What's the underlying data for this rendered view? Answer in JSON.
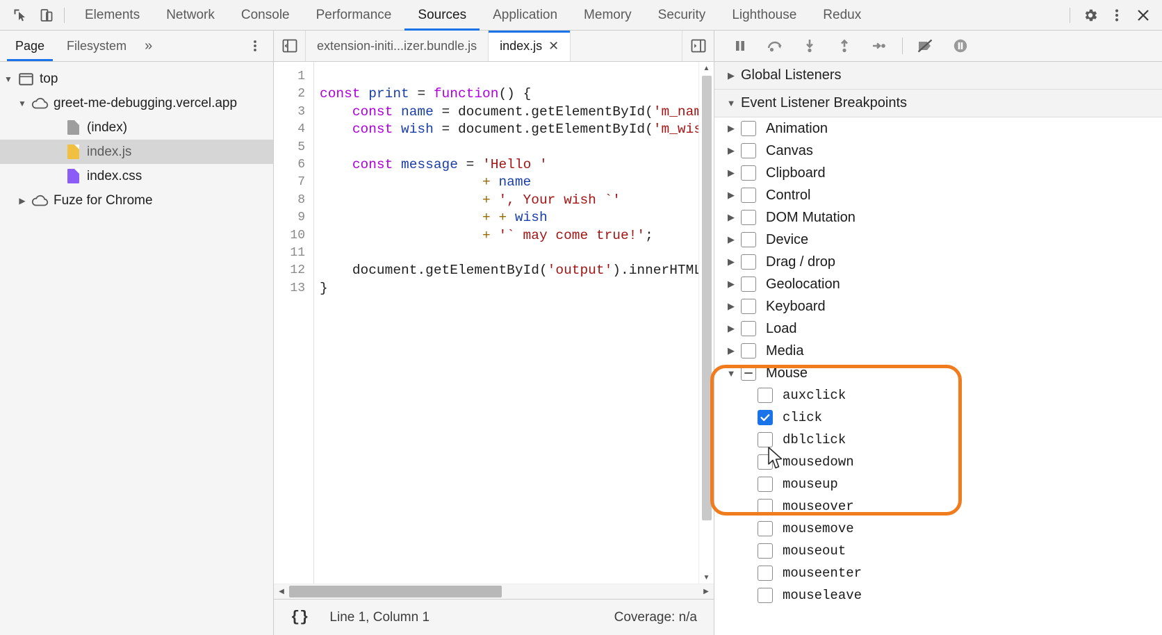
{
  "toolbar": {
    "icons": [
      {
        "name": "inspect-element-icon",
        "title": "Inspect element"
      },
      {
        "name": "device-toolbar-icon",
        "title": "Toggle device toolbar"
      }
    ],
    "tabs": [
      {
        "label": "Elements",
        "active": false
      },
      {
        "label": "Network",
        "active": false
      },
      {
        "label": "Console",
        "active": false
      },
      {
        "label": "Performance",
        "active": false
      },
      {
        "label": "Sources",
        "active": true
      },
      {
        "label": "Application",
        "active": false
      },
      {
        "label": "Memory",
        "active": false
      },
      {
        "label": "Security",
        "active": false
      },
      {
        "label": "Lighthouse",
        "active": false
      },
      {
        "label": "Redux",
        "active": false
      }
    ],
    "right_icons": [
      {
        "name": "gear-icon",
        "title": "Settings"
      },
      {
        "name": "kebab-menu-icon",
        "title": "Customize and control DevTools"
      },
      {
        "name": "close-icon",
        "title": "Close DevTools"
      }
    ]
  },
  "navigator": {
    "tabs": [
      {
        "label": "Page",
        "active": true
      },
      {
        "label": "Filesystem",
        "active": false
      }
    ],
    "more_label": "»",
    "kebab_name": "navigator-more-options",
    "tree": [
      {
        "label": "top",
        "depth": 0,
        "twisty": "▼",
        "icon": "frame-icon",
        "selected": false
      },
      {
        "label": "greet-me-debugging.vercel.app",
        "depth": 1,
        "twisty": "▼",
        "icon": "cloud-icon",
        "selected": false
      },
      {
        "label": "(index)",
        "depth": 2,
        "twisty": "",
        "icon": "document-icon-gray",
        "selected": false
      },
      {
        "label": "index.js",
        "depth": 2,
        "twisty": "",
        "icon": "document-icon-yellow",
        "selected": true
      },
      {
        "label": "index.css",
        "depth": 2,
        "twisty": "",
        "icon": "document-icon-purple",
        "selected": false
      },
      {
        "label": "Fuze for Chrome",
        "depth": 1,
        "twisty": "▶",
        "icon": "cloud-icon",
        "selected": false
      }
    ],
    "icon_colors": {
      "document-icon-gray": "#9e9e9e",
      "document-icon-yellow": "#f0c040",
      "document-icon-purple": "#8b5cf6"
    }
  },
  "editor": {
    "nav_toggle_name": "show-navigator-icon",
    "debug_toggle_name": "show-debugger-icon",
    "tabs": [
      {
        "label": "extension-initi...izer.bundle.js",
        "active": false,
        "closable": false
      },
      {
        "label": "index.js",
        "active": true,
        "closable": true,
        "close_label": "✕"
      }
    ],
    "lines": [
      {
        "num": "1",
        "tokens": []
      },
      {
        "num": "2",
        "tokens": [
          {
            "t": "const",
            "c": "k"
          },
          {
            "t": " ",
            "c": "p"
          },
          {
            "t": "print",
            "c": "v"
          },
          {
            "t": " ",
            "c": "p"
          },
          {
            "t": "=",
            "c": "p"
          },
          {
            "t": " ",
            "c": "p"
          },
          {
            "t": "function",
            "c": "k"
          },
          {
            "t": "() {",
            "c": "p"
          }
        ]
      },
      {
        "num": "3",
        "tokens": [
          {
            "t": "    ",
            "c": "p"
          },
          {
            "t": "const",
            "c": "k"
          },
          {
            "t": " ",
            "c": "p"
          },
          {
            "t": "name",
            "c": "v"
          },
          {
            "t": " = ",
            "c": "p"
          },
          {
            "t": "document",
            "c": "p"
          },
          {
            "t": ".getElementById(",
            "c": "p"
          },
          {
            "t": "'m_name'",
            "c": "s"
          },
          {
            "t": ");",
            "c": "p"
          }
        ]
      },
      {
        "num": "4",
        "tokens": [
          {
            "t": "    ",
            "c": "p"
          },
          {
            "t": "const",
            "c": "k"
          },
          {
            "t": " ",
            "c": "p"
          },
          {
            "t": "wish",
            "c": "v"
          },
          {
            "t": " = ",
            "c": "p"
          },
          {
            "t": "document",
            "c": "p"
          },
          {
            "t": ".getElementById(",
            "c": "p"
          },
          {
            "t": "'m_wish'",
            "c": "s"
          },
          {
            "t": ");",
            "c": "p"
          }
        ]
      },
      {
        "num": "5",
        "tokens": []
      },
      {
        "num": "6",
        "tokens": [
          {
            "t": "    ",
            "c": "p"
          },
          {
            "t": "const",
            "c": "k"
          },
          {
            "t": " ",
            "c": "p"
          },
          {
            "t": "message",
            "c": "v"
          },
          {
            "t": " = ",
            "c": "p"
          },
          {
            "t": "'Hello '",
            "c": "s"
          }
        ]
      },
      {
        "num": "7",
        "tokens": [
          {
            "t": "                    ",
            "c": "p"
          },
          {
            "t": "+",
            "c": "op"
          },
          {
            "t": " ",
            "c": "p"
          },
          {
            "t": "name",
            "c": "v"
          }
        ]
      },
      {
        "num": "8",
        "tokens": [
          {
            "t": "                    ",
            "c": "p"
          },
          {
            "t": "+",
            "c": "op"
          },
          {
            "t": " ",
            "c": "p"
          },
          {
            "t": "', Your wish `'",
            "c": "s"
          }
        ]
      },
      {
        "num": "9",
        "tokens": [
          {
            "t": "                    ",
            "c": "p"
          },
          {
            "t": "+",
            "c": "op"
          },
          {
            "t": " ",
            "c": "p"
          },
          {
            "t": "+",
            "c": "op"
          },
          {
            "t": " ",
            "c": "p"
          },
          {
            "t": "wish",
            "c": "v"
          }
        ]
      },
      {
        "num": "10",
        "tokens": [
          {
            "t": "                    ",
            "c": "p"
          },
          {
            "t": "+",
            "c": "op"
          },
          {
            "t": " ",
            "c": "p"
          },
          {
            "t": "'` may come true!'",
            "c": "s"
          },
          {
            "t": ";",
            "c": "p"
          }
        ]
      },
      {
        "num": "11",
        "tokens": []
      },
      {
        "num": "12",
        "tokens": [
          {
            "t": "    ",
            "c": "p"
          },
          {
            "t": "document",
            "c": "p"
          },
          {
            "t": ".getElementById(",
            "c": "p"
          },
          {
            "t": "'output'",
            "c": "s"
          },
          {
            "t": ").innerHTML",
            "c": "p"
          }
        ]
      },
      {
        "num": "13",
        "tokens": [
          {
            "t": "}",
            "c": "p"
          }
        ]
      }
    ]
  },
  "statusbar": {
    "pretty_print_label": "{}",
    "position": "Line 1, Column 1",
    "coverage": "Coverage: n/a"
  },
  "debugger": {
    "buttons": [
      {
        "name": "pause-script-icon",
        "title": "Pause script execution"
      },
      {
        "name": "step-over-icon",
        "title": "Step over next function call"
      },
      {
        "name": "step-into-icon",
        "title": "Step into next function call"
      },
      {
        "name": "step-out-icon",
        "title": "Step out of current function"
      },
      {
        "name": "step-icon",
        "title": "Step"
      },
      {
        "name": "deactivate-breakpoints-icon",
        "title": "Deactivate breakpoints"
      },
      {
        "name": "pause-on-exceptions-icon",
        "title": "Pause on exceptions"
      }
    ],
    "sections": [
      {
        "label": "Global Listeners",
        "expanded": false,
        "twisty": "▶"
      },
      {
        "label": "Event Listener Breakpoints",
        "expanded": true,
        "twisty": "▼"
      }
    ],
    "groups": [
      {
        "label": "Animation",
        "twisty": "▶",
        "state": "unchecked"
      },
      {
        "label": "Canvas",
        "twisty": "▶",
        "state": "unchecked"
      },
      {
        "label": "Clipboard",
        "twisty": "▶",
        "state": "unchecked"
      },
      {
        "label": "Control",
        "twisty": "▶",
        "state": "unchecked"
      },
      {
        "label": "DOM Mutation",
        "twisty": "▶",
        "state": "unchecked"
      },
      {
        "label": "Device",
        "twisty": "▶",
        "state": "unchecked"
      },
      {
        "label": "Drag / drop",
        "twisty": "▶",
        "state": "unchecked"
      },
      {
        "label": "Geolocation",
        "twisty": "▶",
        "state": "unchecked"
      },
      {
        "label": "Keyboard",
        "twisty": "▶",
        "state": "unchecked"
      },
      {
        "label": "Load",
        "twisty": "▶",
        "state": "unchecked"
      },
      {
        "label": "Media",
        "twisty": "▶",
        "state": "unchecked"
      },
      {
        "label": "Mouse",
        "twisty": "▼",
        "state": "indeterminate"
      }
    ],
    "mouse_events": [
      {
        "label": "auxclick",
        "state": "unchecked"
      },
      {
        "label": "click",
        "state": "checked"
      },
      {
        "label": "dblclick",
        "state": "unchecked"
      },
      {
        "label": "mousedown",
        "state": "unchecked"
      },
      {
        "label": "mouseup",
        "state": "unchecked"
      },
      {
        "label": "mouseover",
        "state": "unchecked"
      },
      {
        "label": "mousemove",
        "state": "unchecked"
      },
      {
        "label": "mouseout",
        "state": "unchecked"
      },
      {
        "label": "mouseenter",
        "state": "unchecked"
      },
      {
        "label": "mouseleave",
        "state": "unchecked"
      }
    ]
  },
  "annotation": {
    "color": "#f07c1e",
    "name": "mouse-breakpoints-highlight"
  },
  "colors": {
    "accent": "#1a73e8",
    "checked_checkbox": "#1a73e8",
    "annotation_orange": "#f07c1e",
    "toolbar_bg": "#f3f3f3",
    "selected_row": "#d6d6d6"
  }
}
